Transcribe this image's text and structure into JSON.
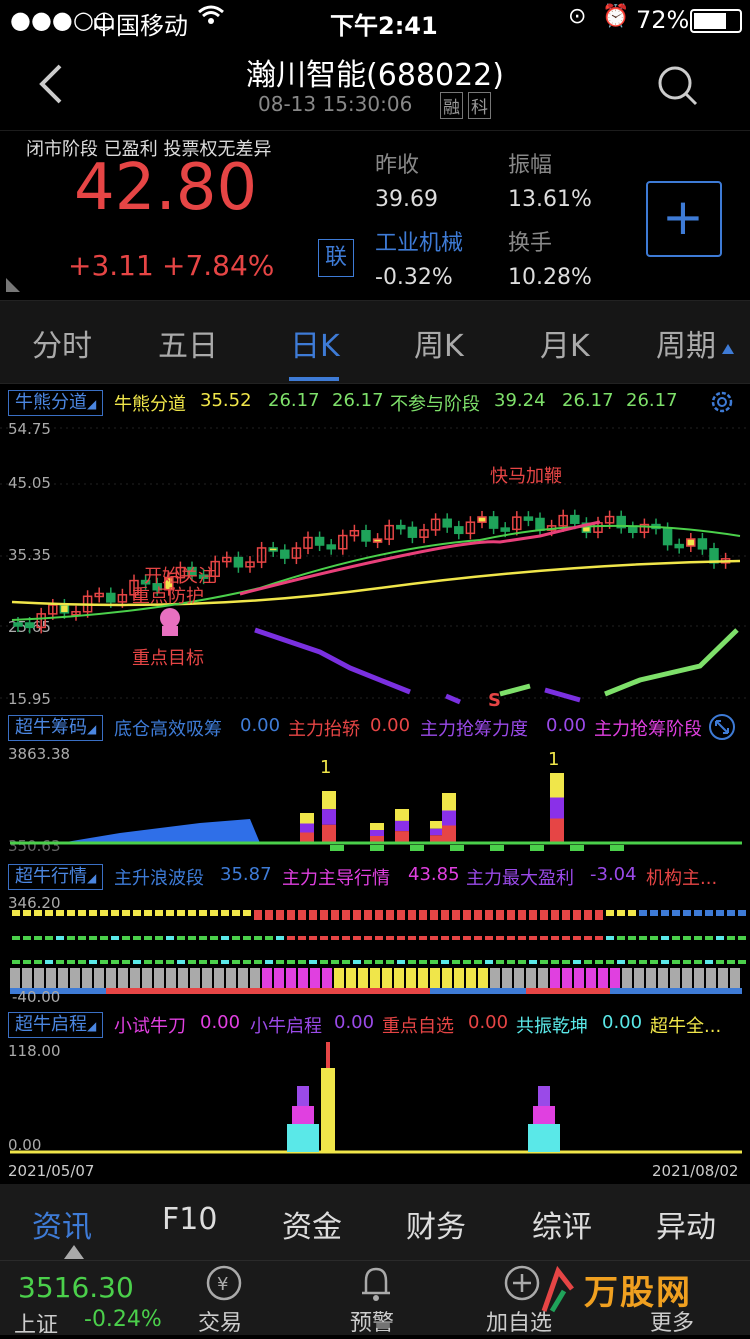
{
  "status_bar": {
    "carrier": "中国移动",
    "time": "下午2:41",
    "battery": "72%"
  },
  "header": {
    "title": "瀚川智能(688022)",
    "datetime": "08-13 15:30:06",
    "badge1": "融",
    "badge2": "科"
  },
  "quote": {
    "stage_info": "闭市阶段  已盈利  投票权无差异",
    "price": "42.80",
    "change": "+3.11",
    "change_pct": "+7.84%",
    "lian": "联",
    "prev_close_label": "昨收",
    "prev_close": "39.69",
    "amplitude_label": "振幅",
    "amplitude": "13.61%",
    "sector_label": "工业机械",
    "sector_change": "-0.32%",
    "turnover_label": "换手",
    "turnover": "10.28%"
  },
  "tabs": [
    "分时",
    "五日",
    "日K",
    "周K",
    "月K",
    "周期"
  ],
  "indicator1": {
    "name": "牛熊分道",
    "items": [
      {
        "label": "牛熊分道",
        "value": "35.52",
        "v2": "26.17",
        "v3": "26.17"
      },
      {
        "label": "不参与阶段",
        "value": "39.24",
        "v2": "26.17",
        "v3": "26.17"
      }
    ],
    "axis": [
      "54.75",
      "45.05",
      "35.35",
      "25.65",
      "15.95"
    ],
    "annotations": [
      "快马加鞭",
      "开始关注",
      "重点防护",
      "重点目标",
      "S"
    ]
  },
  "indicator2": {
    "name": "超牛筹码",
    "items": [
      {
        "label": "底仓高效吸筹",
        "value": "0.00"
      },
      {
        "label": "主力抬轿",
        "value": "0.00"
      },
      {
        "label": "主力抢筹力度",
        "value": "0.00"
      },
      {
        "label": "主力抢筹阶段",
        "value": ""
      }
    ],
    "axis_top": "3863.38",
    "axis_bottom": "350.63",
    "marks": [
      "1",
      "1"
    ]
  },
  "indicator3": {
    "name": "超牛行情",
    "items": [
      {
        "label": "主升浪波段",
        "value": "35.87"
      },
      {
        "label": "主力主导行情",
        "value": "43.85"
      },
      {
        "label": "主力最大盈利",
        "value": "-3.04"
      },
      {
        "label": "机构主...",
        "value": ""
      }
    ],
    "axis_top": "346.20",
    "axis_bottom": "-40.00"
  },
  "indicator4": {
    "name": "超牛启程",
    "items": [
      {
        "label": "小试牛刀",
        "value": "0.00"
      },
      {
        "label": "小牛启程",
        "value": "0.00"
      },
      {
        "label": "重点自选",
        "value": "0.00"
      },
      {
        "label": "共振乾坤",
        "value": "0.00"
      },
      {
        "label": "超牛全...",
        "value": ""
      }
    ],
    "axis_top": "118.00",
    "axis_bottom": "0.00",
    "date_start": "2021/05/07",
    "date_end": "2021/08/02"
  },
  "bottom_tabs": [
    "资讯",
    "F10",
    "资金",
    "财务",
    "综评",
    "异动"
  ],
  "dock": {
    "index_value": "3516.30",
    "index_name": "上证",
    "index_change": "-0.24%",
    "trade_label": "交易",
    "alert_label": "预警",
    "add_label": "加自选",
    "more_label": "更多",
    "watermark": "万股网"
  },
  "colors": {
    "up": "#e64545",
    "down": "#1fa35a",
    "accent": "#3e7bd6",
    "yellow": "#f0e64a"
  }
}
